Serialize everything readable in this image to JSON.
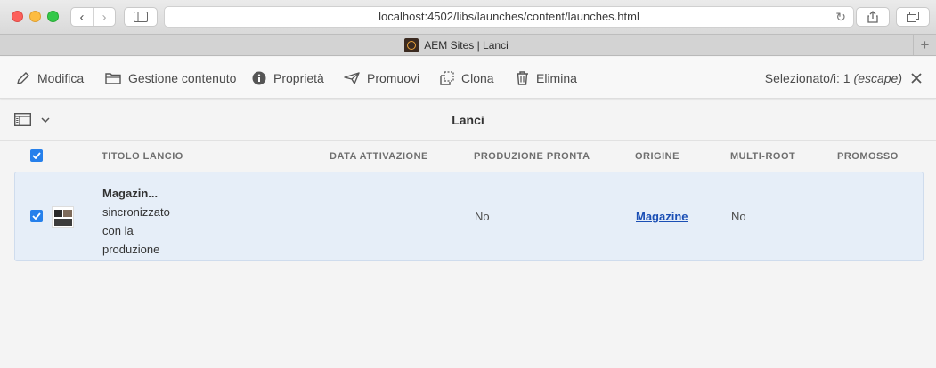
{
  "browser": {
    "url": "localhost:4502/libs/launches/content/launches.html",
    "tab_title": "AEM Sites | Lanci"
  },
  "actionbar": {
    "actions": [
      {
        "label": "Modifica",
        "icon": "pencil-icon"
      },
      {
        "label": "Gestione contenuto",
        "icon": "folder-icon"
      },
      {
        "label": "Proprietà",
        "icon": "info-icon"
      },
      {
        "label": "Promuovi",
        "icon": "send-icon"
      },
      {
        "label": "Clona",
        "icon": "clone-icon"
      },
      {
        "label": "Elimina",
        "icon": "trash-icon"
      }
    ],
    "selection_label": "Selezionato/i: 1",
    "escape_hint": "(escape)"
  },
  "page": {
    "title": "Lanci"
  },
  "table": {
    "columns": [
      "TITOLO LANCIO",
      "DATA ATTIVAZIONE",
      "PRODUZIONE PRONTA",
      "ORIGINE",
      "MULTI-ROOT",
      "PROMOSSO"
    ],
    "rows": [
      {
        "title": "Magazin...",
        "title_lines": [
          "sincronizzato",
          "con la",
          "produzione"
        ],
        "activation_date": "",
        "production_ready": "No",
        "origin": "Magazine",
        "multi_root": "No",
        "promoted": ""
      }
    ]
  },
  "colors": {
    "accent": "#2680eb",
    "row_selected": "#e6eef8",
    "link": "#1b4fb5"
  }
}
